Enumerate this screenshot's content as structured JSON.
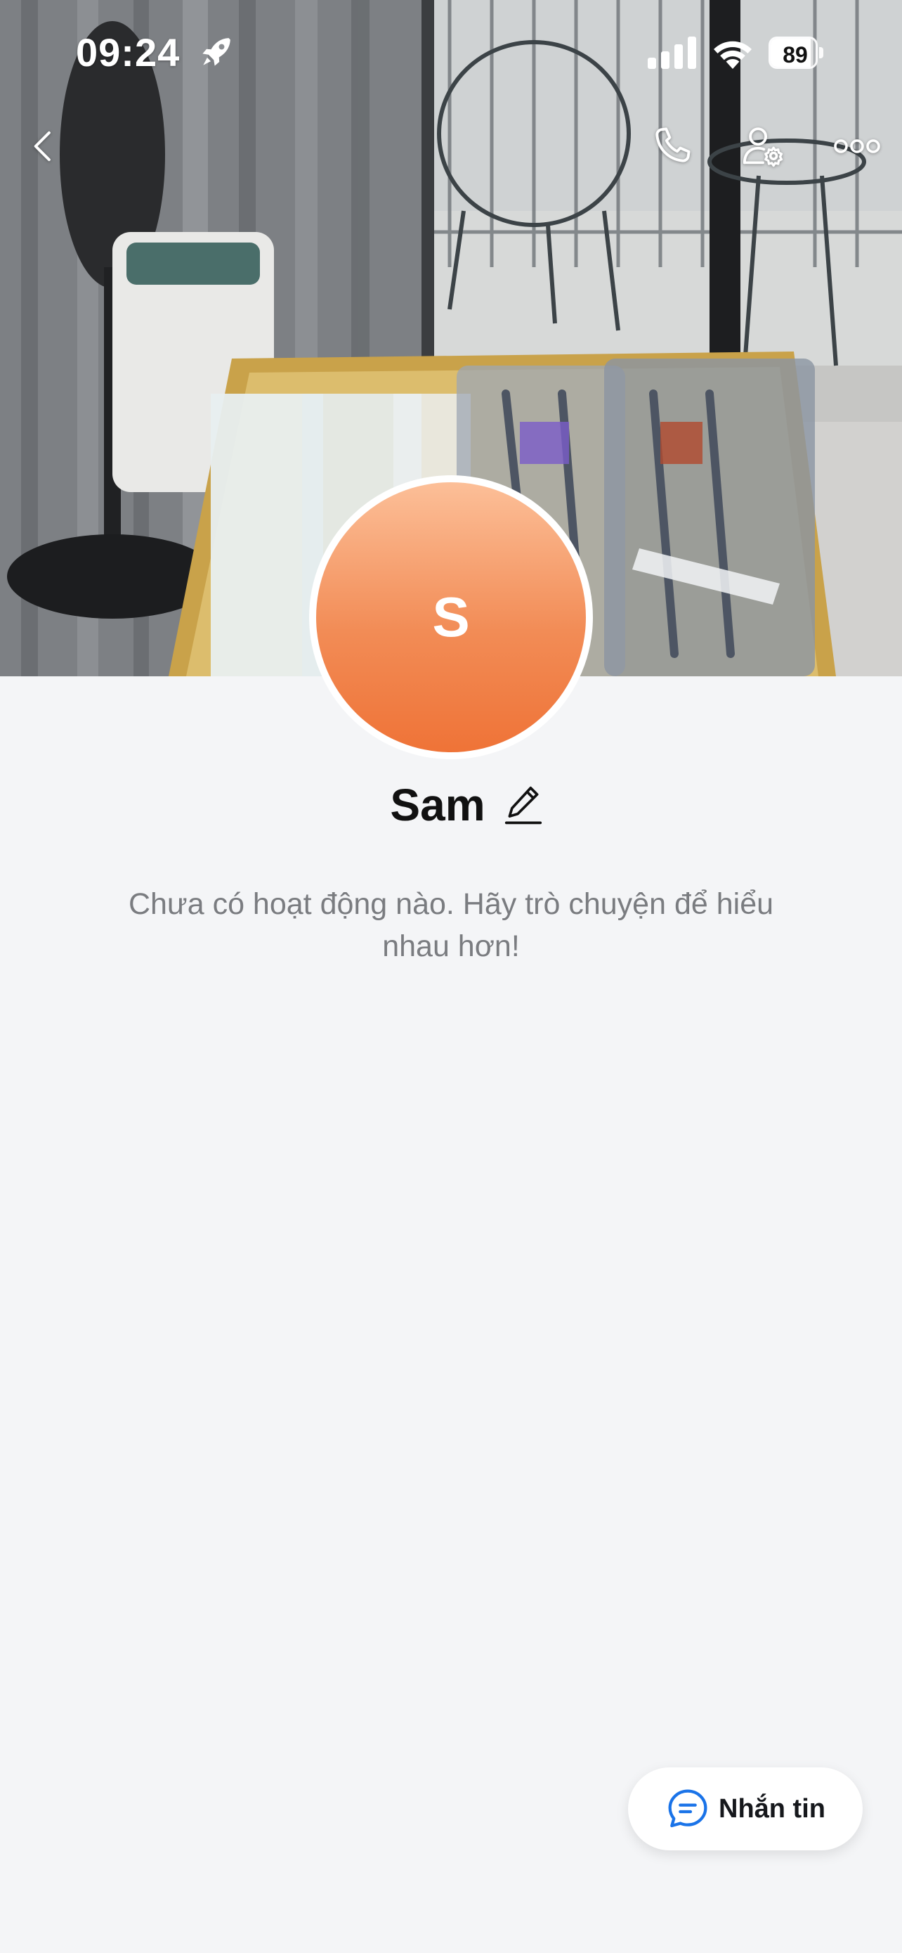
{
  "status_bar": {
    "time": "09:24",
    "battery_level": "89",
    "battery_fraction": 0.89,
    "icons": [
      "rocket-icon",
      "signal-icon",
      "wifi-icon",
      "battery-icon"
    ]
  },
  "nav": {
    "back_icon": "chevron-left-icon",
    "call_icon": "phone-icon",
    "settings_icon": "user-settings-icon",
    "more_icon": "more-horizontal-icon"
  },
  "profile": {
    "avatar_initial": "S",
    "name": "Sam",
    "edit_icon": "pencil-icon"
  },
  "empty_state": {
    "message": "Chưa có hoạt động nào. Hãy trò chuyện để hiểu nhau hơn!"
  },
  "message_button": {
    "label": "Nhắn tin",
    "icon": "chat-bubble-icon"
  },
  "colors": {
    "background": "#f4f5f7",
    "avatar_top": "#fcbf98",
    "avatar_bottom": "#ef7337",
    "accent_blue": "#1a73e8",
    "name_text": "#111111",
    "muted_text": "#7a7c80"
  }
}
